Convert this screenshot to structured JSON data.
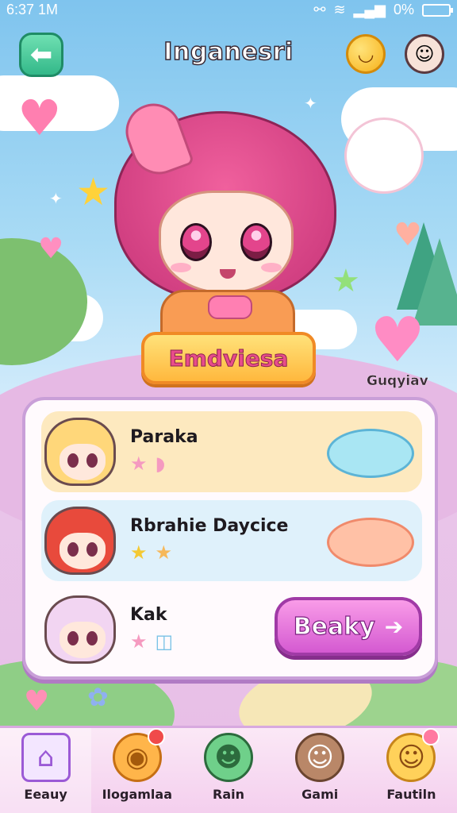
{
  "status_bar": {
    "time": "6:37 1M",
    "battery": "0%"
  },
  "header": {
    "title": "Inganesri"
  },
  "hero": {
    "name": "Emdviesa",
    "side_caption": "Guqyiav"
  },
  "roster": [
    {
      "name": "Paraka"
    },
    {
      "name": "Rbrahie Daycice"
    },
    {
      "name": "Kak"
    }
  ],
  "play_button": {
    "label": "Beaky"
  },
  "nav": [
    {
      "label": "Eeauy",
      "icon": "house-icon"
    },
    {
      "label": "Ilogamlaa",
      "icon": "bread-icon"
    },
    {
      "label": "Rain",
      "icon": "cat-character-icon"
    },
    {
      "label": "Gami",
      "icon": "cat-face-icon"
    },
    {
      "label": "Fautiln",
      "icon": "girl-character-icon"
    }
  ],
  "colors": {
    "accent_pink": "#d45ad1",
    "panel_border": "#c99fd8",
    "back_green": "#33b889",
    "banner_yellow": "#ffb83d"
  }
}
